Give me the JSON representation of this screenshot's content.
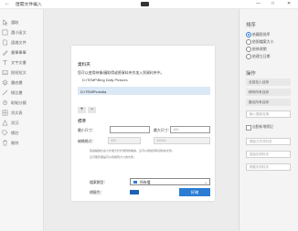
{
  "window": {
    "title": "匯開文件編入",
    "back_glyph": "←",
    "minimize_glyph": "—",
    "maximize_glyph": "□",
    "close_glyph": "✕"
  },
  "sidebar": {
    "items": [
      {
        "label": "選取",
        "icon": "pointer-icon"
      },
      {
        "label": "選小區文",
        "icon": "shapes-icon"
      },
      {
        "label": "語譜文件",
        "icon": "document-icon"
      },
      {
        "label": "畫筆筆筆",
        "icon": "pen-icon"
      },
      {
        "label": "文宇文書",
        "icon": "text-icon"
      },
      {
        "label": "照短短文",
        "icon": "image-icon"
      },
      {
        "label": "畫底層",
        "icon": "layers-icon"
      },
      {
        "label": "線比層",
        "icon": "line-icon"
      },
      {
        "label": "取點分鏡",
        "icon": "point-icon"
      },
      {
        "label": "消文表",
        "icon": "table-icon"
      },
      {
        "label": "消沉",
        "icon": "shape-icon"
      },
      {
        "label": "標註",
        "icon": "tag-icon"
      },
      {
        "label": "刪除",
        "icon": "trash-icon"
      }
    ]
  },
  "dialog": {
    "section_folder": "資料夾",
    "folder_description": "您可以使用映像/圖取得或將資料夾作加入到資料夾中。",
    "folder_path_label": "D:\\TEMP\\Bing Daily Pictures",
    "selected_folder": "D:\\TEMP\\media",
    "add_glyph": "+",
    "remove_glyph": "−",
    "section_standard": "標準",
    "min_size_label": "最小尺寸：",
    "min_size_value": "",
    "max_size_label": "最大尺寸：",
    "max_size_value": "100",
    "thumb_label": "縮略格式：",
    "thumb_value_a": "320",
    "thumb_value_b": "10064",
    "fine_print_1": "建議縮放比在小於或大於於或到的檔案，這可以用當資料資料夾文件。",
    "fine_print_2": "這可能影響是可以到或到大小的文件。",
    "file_type_label": "檔案類型：",
    "file_type_value": "所有檔",
    "color_label": "標籤色：",
    "ok_label": "好確"
  },
  "right_panel": {
    "heading_options": "排序",
    "radios": [
      {
        "label": "依圖段排序",
        "checked": true
      },
      {
        "label": "依照檔案大小",
        "checked": false
      },
      {
        "label": "依修改期",
        "checked": false
      },
      {
        "label": "依建立日期",
        "checked": false
      }
    ],
    "heading_actions": "操作",
    "buttons": [
      "全部加入目錄",
      "移除所有目錄",
      "匯出所有目錄"
    ],
    "input_placeholder": "輸入檔案名稱",
    "checkbox_label": "自動新增標記",
    "disabled_buttons": [
      "開啟文件資料夾",
      "複製到資料夾",
      "移動到資料夾"
    ]
  },
  "colors": {
    "accent": "#2b7cd3",
    "selected_row": "#dbe8f6",
    "label_swatch": "#1d62b5"
  }
}
